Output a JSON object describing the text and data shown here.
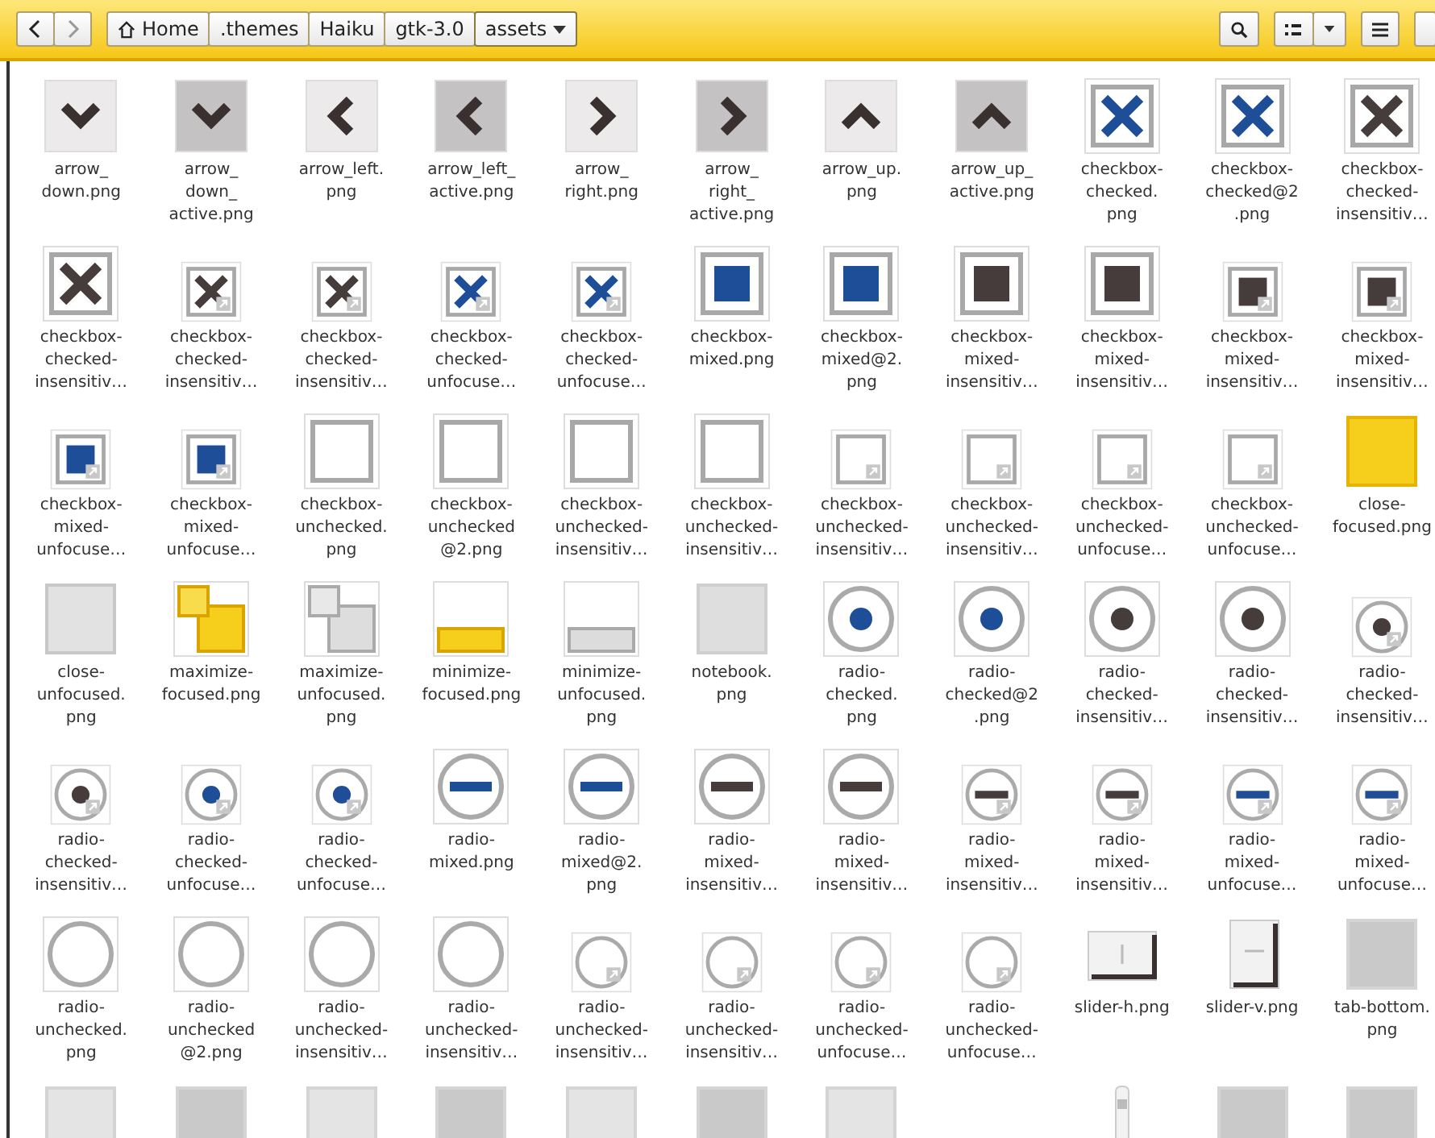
{
  "toolbar": {
    "back": {
      "disabled": false
    },
    "forward": {
      "disabled": true
    },
    "path": [
      {
        "label": "Home",
        "kind": "home",
        "selected": false
      },
      {
        "label": ".themes",
        "kind": "folder",
        "selected": false
      },
      {
        "label": "Haiku",
        "kind": "folder",
        "selected": false
      },
      {
        "label": "gtk-3.0",
        "kind": "folder",
        "selected": false
      },
      {
        "label": "assets",
        "kind": "menu",
        "selected": true
      }
    ]
  },
  "files": [
    {
      "kind": "arrowdown",
      "active": false,
      "lines": [
        "arrow_",
        "down.png"
      ]
    },
    {
      "kind": "arrowdown",
      "active": true,
      "lines": [
        "arrow_",
        "down_",
        "active.png"
      ]
    },
    {
      "kind": "arrowleft",
      "active": false,
      "lines": [
        "arrow_left.",
        "png"
      ]
    },
    {
      "kind": "arrowleft",
      "active": true,
      "lines": [
        "arrow_left_",
        "active.png"
      ]
    },
    {
      "kind": "arrowright",
      "active": false,
      "lines": [
        "arrow_",
        "right.png"
      ]
    },
    {
      "kind": "arrowright",
      "active": true,
      "lines": [
        "arrow_",
        "right_",
        "active.png"
      ]
    },
    {
      "kind": "arrowup",
      "active": false,
      "lines": [
        "arrow_up.",
        "png"
      ]
    },
    {
      "kind": "arrowup",
      "active": true,
      "lines": [
        "arrow_up_",
        "active.png"
      ]
    },
    {
      "kind": "checkbox",
      "color": "#1f4e99",
      "link": false,
      "lines": [
        "checkbox-",
        "checked.",
        "png"
      ]
    },
    {
      "kind": "checkbox",
      "color": "#1f4e99",
      "link": false,
      "lines": [
        "checkbox-",
        "checked@2",
        ".png"
      ]
    },
    {
      "kind": "checkbox",
      "color": "#463c3c",
      "link": false,
      "lines": [
        "checkbox-",
        "checked-",
        "insensitiv…"
      ]
    },
    {
      "kind": "checkbox",
      "color": "#463c3c",
      "link": false,
      "lines": [
        "checkbox-",
        "checked-",
        "insensitiv…"
      ]
    },
    {
      "kind": "checkbox",
      "color": "#463c3c",
      "link": true,
      "lines": [
        "checkbox-",
        "checked-",
        "insensitiv…"
      ]
    },
    {
      "kind": "checkbox",
      "color": "#463c3c",
      "link": true,
      "lines": [
        "checkbox-",
        "checked-",
        "insensitiv…"
      ]
    },
    {
      "kind": "checkbox",
      "color": "#1f4e99",
      "link": true,
      "lines": [
        "checkbox-",
        "checked-",
        "unfocuse…"
      ]
    },
    {
      "kind": "checkbox",
      "color": "#1f4e99",
      "link": true,
      "lines": [
        "checkbox-",
        "checked-",
        "unfocuse…"
      ]
    },
    {
      "kind": "checkboxmixed",
      "color": "#1f4e99",
      "link": false,
      "lines": [
        "checkbox-",
        "mixed.png"
      ]
    },
    {
      "kind": "checkboxmixed",
      "color": "#1f4e99",
      "link": false,
      "lines": [
        "checkbox-",
        "mixed@2.",
        "png"
      ]
    },
    {
      "kind": "checkboxmixed",
      "color": "#463c3c",
      "link": false,
      "lines": [
        "checkbox-",
        "mixed-",
        "insensitiv…"
      ]
    },
    {
      "kind": "checkboxmixed",
      "color": "#463c3c",
      "link": false,
      "lines": [
        "checkbox-",
        "mixed-",
        "insensitiv…"
      ]
    },
    {
      "kind": "checkboxmixed",
      "color": "#463c3c",
      "link": true,
      "lines": [
        "checkbox-",
        "mixed-",
        "insensitiv…"
      ]
    },
    {
      "kind": "checkboxmixed",
      "color": "#463c3c",
      "link": true,
      "lines": [
        "checkbox-",
        "mixed-",
        "insensitiv…"
      ]
    },
    {
      "kind": "checkboxmixed",
      "color": "#1f4e99",
      "link": true,
      "lines": [
        "checkbox-",
        "mixed-",
        "unfocuse…"
      ]
    },
    {
      "kind": "checkboxmixed",
      "color": "#1f4e99",
      "link": true,
      "lines": [
        "checkbox-",
        "mixed-",
        "unfocuse…"
      ]
    },
    {
      "kind": "checkboxempty",
      "link": false,
      "lines": [
        "checkbox-",
        "unchecked.",
        "png"
      ]
    },
    {
      "kind": "checkboxempty",
      "link": false,
      "lines": [
        "checkbox-",
        "unchecked",
        "@2.png"
      ]
    },
    {
      "kind": "checkboxempty",
      "link": false,
      "lines": [
        "checkbox-",
        "unchecked-",
        "insensitiv…"
      ]
    },
    {
      "kind": "checkboxempty",
      "link": false,
      "lines": [
        "checkbox-",
        "unchecked-",
        "insensitiv…"
      ]
    },
    {
      "kind": "checkboxempty",
      "link": true,
      "lines": [
        "checkbox-",
        "unchecked-",
        "insensitiv…"
      ]
    },
    {
      "kind": "checkboxempty",
      "link": true,
      "lines": [
        "checkbox-",
        "unchecked-",
        "insensitiv…"
      ]
    },
    {
      "kind": "checkboxempty",
      "link": true,
      "lines": [
        "checkbox-",
        "unchecked-",
        "unfocuse…"
      ]
    },
    {
      "kind": "checkboxempty",
      "link": true,
      "lines": [
        "checkbox-",
        "unchecked-",
        "unfocuse…"
      ]
    },
    {
      "kind": "close",
      "focused": true,
      "lines": [
        "close-",
        "focused.png"
      ]
    },
    {
      "kind": "close",
      "focused": false,
      "lines": [
        "close-",
        "unfocused.",
        "png"
      ]
    },
    {
      "kind": "maximize",
      "focused": true,
      "lines": [
        "maximize-",
        "focused.png"
      ]
    },
    {
      "kind": "maximize",
      "focused": false,
      "lines": [
        "maximize-",
        "unfocused.",
        "png"
      ]
    },
    {
      "kind": "minimize",
      "focused": true,
      "lines": [
        "minimize-",
        "focused.png"
      ]
    },
    {
      "kind": "minimize",
      "focused": false,
      "lines": [
        "minimize-",
        "unfocused.",
        "png"
      ]
    },
    {
      "kind": "notebook",
      "lines": [
        "notebook.",
        "png"
      ]
    },
    {
      "kind": "radio",
      "color": "#1f4e99",
      "link": false,
      "lines": [
        "radio-",
        "checked.",
        "png"
      ]
    },
    {
      "kind": "radio",
      "color": "#1f4e99",
      "link": false,
      "lines": [
        "radio-",
        "checked@2",
        ".png"
      ]
    },
    {
      "kind": "radio",
      "color": "#463c3c",
      "link": false,
      "lines": [
        "radio-",
        "checked-",
        "insensitiv…"
      ]
    },
    {
      "kind": "radio",
      "color": "#463c3c",
      "link": false,
      "lines": [
        "radio-",
        "checked-",
        "insensitiv…"
      ]
    },
    {
      "kind": "radio",
      "color": "#463c3c",
      "link": true,
      "lines": [
        "radio-",
        "checked-",
        "insensitiv…"
      ]
    },
    {
      "kind": "radio",
      "color": "#463c3c",
      "link": true,
      "lines": [
        "radio-",
        "checked-",
        "insensitiv…"
      ]
    },
    {
      "kind": "radio",
      "color": "#1f4e99",
      "link": true,
      "lines": [
        "radio-",
        "checked-",
        "unfocuse…"
      ]
    },
    {
      "kind": "radio",
      "color": "#1f4e99",
      "link": true,
      "lines": [
        "radio-",
        "checked-",
        "unfocuse…"
      ]
    },
    {
      "kind": "radiomixed",
      "color": "#1f4e99",
      "link": false,
      "lines": [
        "radio-",
        "mixed.png"
      ]
    },
    {
      "kind": "radiomixed",
      "color": "#1f4e99",
      "link": false,
      "lines": [
        "radio-",
        "mixed@2.",
        "png"
      ]
    },
    {
      "kind": "radiomixed",
      "color": "#463c3c",
      "link": false,
      "lines": [
        "radio-",
        "mixed-",
        "insensitiv…"
      ]
    },
    {
      "kind": "radiomixed",
      "color": "#463c3c",
      "link": false,
      "lines": [
        "radio-",
        "mixed-",
        "insensitiv…"
      ]
    },
    {
      "kind": "radiomixed",
      "color": "#463c3c",
      "link": true,
      "lines": [
        "radio-",
        "mixed-",
        "insensitiv…"
      ]
    },
    {
      "kind": "radiomixed",
      "color": "#463c3c",
      "link": true,
      "lines": [
        "radio-",
        "mixed-",
        "insensitiv…"
      ]
    },
    {
      "kind": "radiomixed",
      "color": "#1f4e99",
      "link": true,
      "lines": [
        "radio-",
        "mixed-",
        "unfocuse…"
      ]
    },
    {
      "kind": "radiomixed",
      "color": "#1f4e99",
      "link": true,
      "lines": [
        "radio-",
        "mixed-",
        "unfocuse…"
      ]
    },
    {
      "kind": "radioempty",
      "link": false,
      "lines": [
        "radio-",
        "unchecked.",
        "png"
      ]
    },
    {
      "kind": "radioempty",
      "link": false,
      "lines": [
        "radio-",
        "unchecked",
        "@2.png"
      ]
    },
    {
      "kind": "radioempty",
      "link": false,
      "lines": [
        "radio-",
        "unchecked-",
        "insensitiv…"
      ]
    },
    {
      "kind": "radioempty",
      "link": false,
      "lines": [
        "radio-",
        "unchecked-",
        "insensitiv…"
      ]
    },
    {
      "kind": "radioempty",
      "link": true,
      "lines": [
        "radio-",
        "unchecked-",
        "insensitiv…"
      ]
    },
    {
      "kind": "radioempty",
      "link": true,
      "lines": [
        "radio-",
        "unchecked-",
        "insensitiv…"
      ]
    },
    {
      "kind": "radioempty",
      "link": true,
      "lines": [
        "radio-",
        "unchecked-",
        "unfocuse…"
      ]
    },
    {
      "kind": "radioempty",
      "link": true,
      "lines": [
        "radio-",
        "unchecked-",
        "unfocuse…"
      ]
    },
    {
      "kind": "sliderh",
      "lines": [
        "slider-h.png"
      ]
    },
    {
      "kind": "sliderv",
      "lines": [
        "slider-v.png"
      ]
    },
    {
      "kind": "tile",
      "light": false,
      "lines": [
        "tab-bottom.",
        "png"
      ]
    },
    {
      "kind": "tile",
      "light": true
    },
    {
      "kind": "tile",
      "light": false
    },
    {
      "kind": "tile",
      "light": true
    },
    {
      "kind": "tile",
      "light": false
    },
    {
      "kind": "tile",
      "light": true
    },
    {
      "kind": "tile",
      "light": false
    },
    {
      "kind": "tile",
      "light": true
    },
    {
      "kind": "empty"
    },
    {
      "kind": "scrollbar"
    },
    {
      "kind": "tile",
      "light": false
    },
    {
      "kind": "tile",
      "light": false
    }
  ]
}
